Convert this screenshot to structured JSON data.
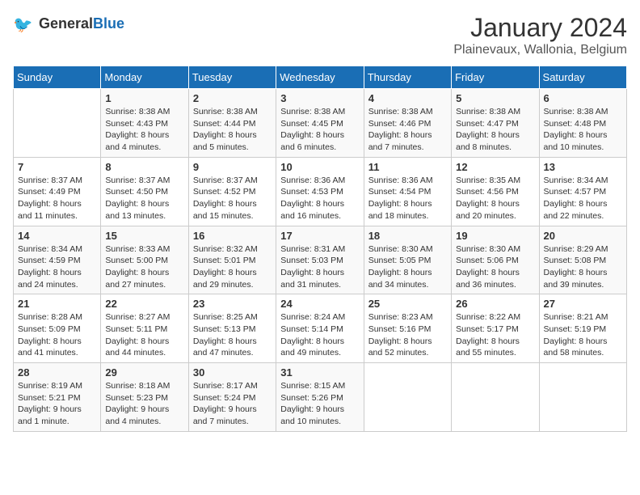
{
  "header": {
    "logo_line1": "General",
    "logo_line2": "Blue",
    "title": "January 2024",
    "subtitle": "Plainevaux, Wallonia, Belgium"
  },
  "calendar": {
    "weekdays": [
      "Sunday",
      "Monday",
      "Tuesday",
      "Wednesday",
      "Thursday",
      "Friday",
      "Saturday"
    ],
    "weeks": [
      [
        {
          "day": "",
          "details": ""
        },
        {
          "day": "1",
          "details": "Sunrise: 8:38 AM\nSunset: 4:43 PM\nDaylight: 8 hours\nand 4 minutes."
        },
        {
          "day": "2",
          "details": "Sunrise: 8:38 AM\nSunset: 4:44 PM\nDaylight: 8 hours\nand 5 minutes."
        },
        {
          "day": "3",
          "details": "Sunrise: 8:38 AM\nSunset: 4:45 PM\nDaylight: 8 hours\nand 6 minutes."
        },
        {
          "day": "4",
          "details": "Sunrise: 8:38 AM\nSunset: 4:46 PM\nDaylight: 8 hours\nand 7 minutes."
        },
        {
          "day": "5",
          "details": "Sunrise: 8:38 AM\nSunset: 4:47 PM\nDaylight: 8 hours\nand 8 minutes."
        },
        {
          "day": "6",
          "details": "Sunrise: 8:38 AM\nSunset: 4:48 PM\nDaylight: 8 hours\nand 10 minutes."
        }
      ],
      [
        {
          "day": "7",
          "details": "Sunrise: 8:37 AM\nSunset: 4:49 PM\nDaylight: 8 hours\nand 11 minutes."
        },
        {
          "day": "8",
          "details": "Sunrise: 8:37 AM\nSunset: 4:50 PM\nDaylight: 8 hours\nand 13 minutes."
        },
        {
          "day": "9",
          "details": "Sunrise: 8:37 AM\nSunset: 4:52 PM\nDaylight: 8 hours\nand 15 minutes."
        },
        {
          "day": "10",
          "details": "Sunrise: 8:36 AM\nSunset: 4:53 PM\nDaylight: 8 hours\nand 16 minutes."
        },
        {
          "day": "11",
          "details": "Sunrise: 8:36 AM\nSunset: 4:54 PM\nDaylight: 8 hours\nand 18 minutes."
        },
        {
          "day": "12",
          "details": "Sunrise: 8:35 AM\nSunset: 4:56 PM\nDaylight: 8 hours\nand 20 minutes."
        },
        {
          "day": "13",
          "details": "Sunrise: 8:34 AM\nSunset: 4:57 PM\nDaylight: 8 hours\nand 22 minutes."
        }
      ],
      [
        {
          "day": "14",
          "details": "Sunrise: 8:34 AM\nSunset: 4:59 PM\nDaylight: 8 hours\nand 24 minutes."
        },
        {
          "day": "15",
          "details": "Sunrise: 8:33 AM\nSunset: 5:00 PM\nDaylight: 8 hours\nand 27 minutes."
        },
        {
          "day": "16",
          "details": "Sunrise: 8:32 AM\nSunset: 5:01 PM\nDaylight: 8 hours\nand 29 minutes."
        },
        {
          "day": "17",
          "details": "Sunrise: 8:31 AM\nSunset: 5:03 PM\nDaylight: 8 hours\nand 31 minutes."
        },
        {
          "day": "18",
          "details": "Sunrise: 8:30 AM\nSunset: 5:05 PM\nDaylight: 8 hours\nand 34 minutes."
        },
        {
          "day": "19",
          "details": "Sunrise: 8:30 AM\nSunset: 5:06 PM\nDaylight: 8 hours\nand 36 minutes."
        },
        {
          "day": "20",
          "details": "Sunrise: 8:29 AM\nSunset: 5:08 PM\nDaylight: 8 hours\nand 39 minutes."
        }
      ],
      [
        {
          "day": "21",
          "details": "Sunrise: 8:28 AM\nSunset: 5:09 PM\nDaylight: 8 hours\nand 41 minutes."
        },
        {
          "day": "22",
          "details": "Sunrise: 8:27 AM\nSunset: 5:11 PM\nDaylight: 8 hours\nand 44 minutes."
        },
        {
          "day": "23",
          "details": "Sunrise: 8:25 AM\nSunset: 5:13 PM\nDaylight: 8 hours\nand 47 minutes."
        },
        {
          "day": "24",
          "details": "Sunrise: 8:24 AM\nSunset: 5:14 PM\nDaylight: 8 hours\nand 49 minutes."
        },
        {
          "day": "25",
          "details": "Sunrise: 8:23 AM\nSunset: 5:16 PM\nDaylight: 8 hours\nand 52 minutes."
        },
        {
          "day": "26",
          "details": "Sunrise: 8:22 AM\nSunset: 5:17 PM\nDaylight: 8 hours\nand 55 minutes."
        },
        {
          "day": "27",
          "details": "Sunrise: 8:21 AM\nSunset: 5:19 PM\nDaylight: 8 hours\nand 58 minutes."
        }
      ],
      [
        {
          "day": "28",
          "details": "Sunrise: 8:19 AM\nSunset: 5:21 PM\nDaylight: 9 hours\nand 1 minute."
        },
        {
          "day": "29",
          "details": "Sunrise: 8:18 AM\nSunset: 5:23 PM\nDaylight: 9 hours\nand 4 minutes."
        },
        {
          "day": "30",
          "details": "Sunrise: 8:17 AM\nSunset: 5:24 PM\nDaylight: 9 hours\nand 7 minutes."
        },
        {
          "day": "31",
          "details": "Sunrise: 8:15 AM\nSunset: 5:26 PM\nDaylight: 9 hours\nand 10 minutes."
        },
        {
          "day": "",
          "details": ""
        },
        {
          "day": "",
          "details": ""
        },
        {
          "day": "",
          "details": ""
        }
      ]
    ]
  }
}
